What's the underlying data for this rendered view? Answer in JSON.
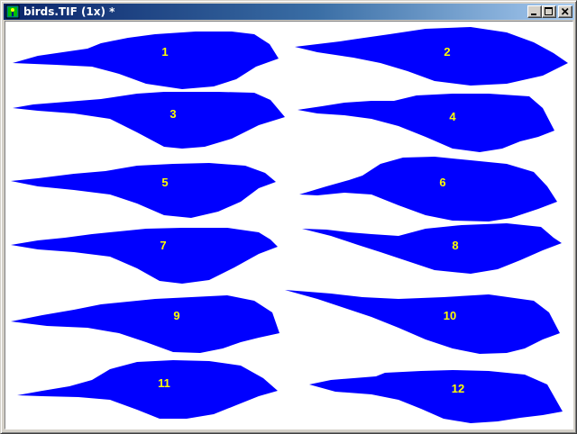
{
  "window": {
    "title": "birds.TIF (1x) *",
    "icon": "image-app-icon",
    "controls": [
      "minimize-icon",
      "maximize-icon",
      "close-icon"
    ]
  },
  "image": {
    "fill_color": "#0000ff",
    "label_color": "#ffff00",
    "background": "#ffffff",
    "labels": [
      "1",
      "2",
      "3",
      "4",
      "5",
      "6",
      "7",
      "8",
      "9",
      "10",
      "11",
      "12"
    ]
  }
}
